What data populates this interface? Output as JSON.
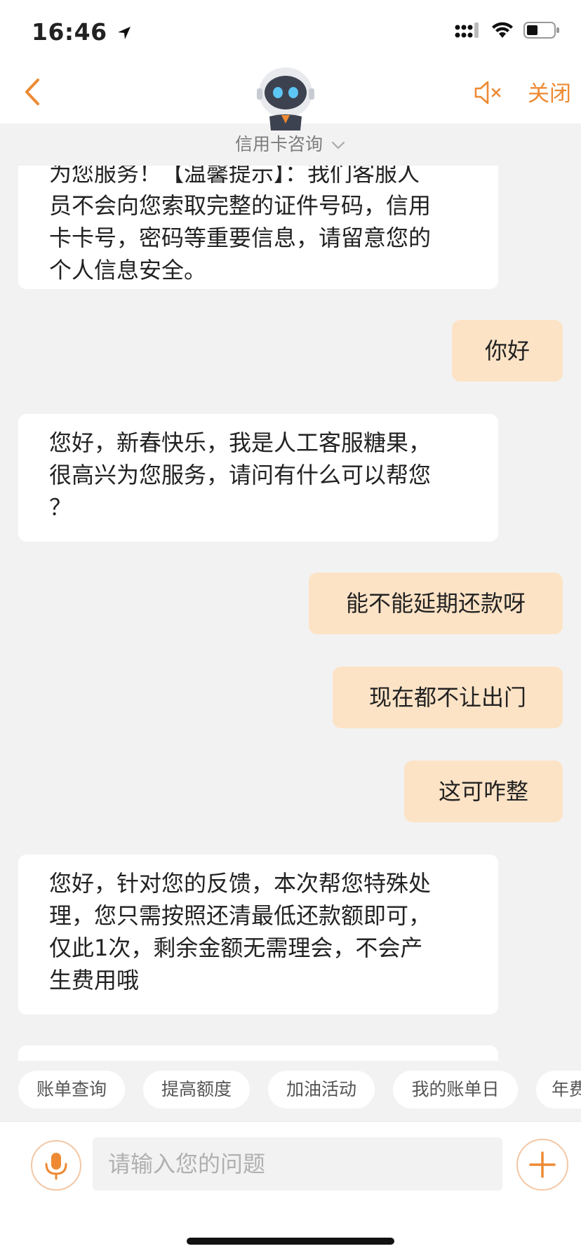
{
  "status_bar": {
    "time": "16:46"
  },
  "nav": {
    "close_label": "关闭",
    "subtitle": "信用卡咨询"
  },
  "messages": [
    {
      "from": "bot",
      "lines": [
        "为您服务！【温馨提示】：我们客服人",
        "员不会向您索取完整的证件号码，信用",
        "卡卡号，密码等重要信息，请留意您的",
        "个人信息安全。"
      ]
    },
    {
      "from": "user",
      "text": "你好"
    },
    {
      "from": "bot",
      "lines": [
        "您好，新春快乐，我是人工客服糖果，",
        "很高兴为您服务，请问有什么可以帮您",
        "？"
      ]
    },
    {
      "from": "user",
      "text": "能不能延期还款呀"
    },
    {
      "from": "user",
      "text": "现在都不让出门"
    },
    {
      "from": "user",
      "text": "这可咋整"
    },
    {
      "from": "bot",
      "lines": [
        "您好，针对您的反馈，本次帮您特殊处",
        "理，您只需按照还清最低还款额即可，",
        "仅此1次，剩余金额无需理会，不会产",
        "生费用哦"
      ]
    }
  ],
  "quick_chips": [
    "账单查询",
    "提高额度",
    "加油活动",
    "我的账单日",
    "年费"
  ],
  "input": {
    "placeholder": "请输入您的问题"
  },
  "colors": {
    "accent": "#ee8a33",
    "user_bubble": "#fde3c6",
    "background": "#f2f2f2"
  },
  "icons": [
    "location-arrow-icon",
    "signal-icon",
    "wifi-icon",
    "battery-icon",
    "back-chevron-icon",
    "robot-avatar-icon",
    "mute-speaker-icon",
    "chevron-down-icon",
    "microphone-icon",
    "plus-icon"
  ]
}
